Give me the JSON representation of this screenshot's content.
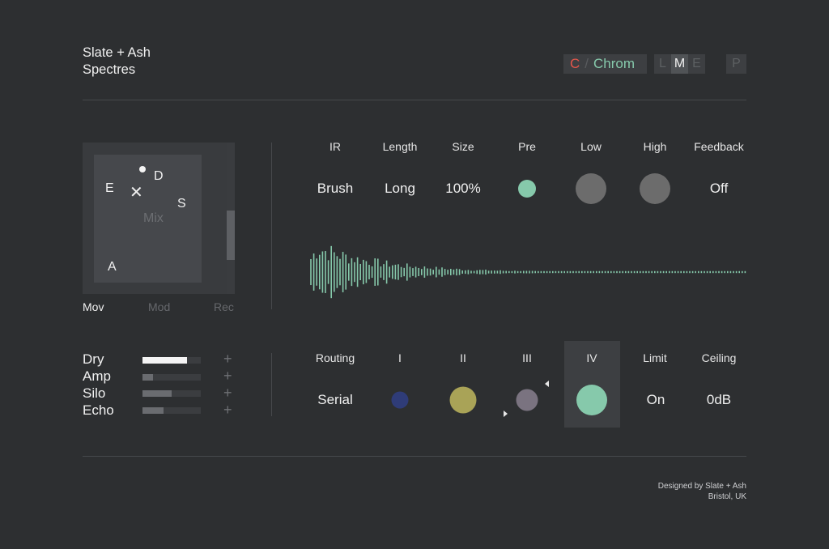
{
  "brand": {
    "line1": "Slate + Ash",
    "line2": "Spectres"
  },
  "preset": {
    "letter": "C",
    "sep": "/",
    "name": "Chrom"
  },
  "modes": [
    "L",
    "M",
    "E",
    "P"
  ],
  "active_mode": "M",
  "xy_pad": {
    "points": {
      "e": "E",
      "d": "D",
      "s": "S",
      "a": "A"
    },
    "center_label": "Mix",
    "tabs": [
      "Mov",
      "Mod",
      "Rec"
    ],
    "active_tab": "Mov",
    "scroll_position": 0.67
  },
  "params": {
    "ir": {
      "label": "IR",
      "value": "Brush"
    },
    "length": {
      "label": "Length",
      "value": "Long"
    },
    "size": {
      "label": "Size",
      "value": "100%"
    },
    "pre": {
      "label": "Pre"
    },
    "low": {
      "label": "Low"
    },
    "high": {
      "label": "High"
    },
    "feedback": {
      "label": "Feedback",
      "value": "Off"
    }
  },
  "sends": [
    {
      "label": "Dry",
      "level": 0.76,
      "color": "#f4f4f4"
    },
    {
      "label": "Amp",
      "level": 0.18,
      "color": "#6a6c70"
    },
    {
      "label": "Silo",
      "level": 0.5,
      "color": "#6a6c70"
    },
    {
      "label": "Echo",
      "level": 0.36,
      "color": "#6a6c70"
    }
  ],
  "routing": {
    "routing": {
      "label": "Routing",
      "value": "Serial"
    },
    "i": {
      "label": "I",
      "color": "#2f3c78"
    },
    "ii": {
      "label": "II",
      "color": "#a9a357"
    },
    "iii": {
      "label": "III",
      "color": "#7a7380"
    },
    "iv": {
      "label": "IV",
      "color": "#86c9ab"
    },
    "limit": {
      "label": "Limit",
      "value": "On"
    },
    "ceiling": {
      "label": "Ceiling",
      "value": "0dB"
    }
  },
  "colors": {
    "accent": "#86c9ab",
    "knob_grey": "#6c6c6c",
    "preset_letter": "#e2564b"
  },
  "footer": {
    "line1": "Designed by Slate + Ash",
    "line2": "Bristol, UK"
  }
}
